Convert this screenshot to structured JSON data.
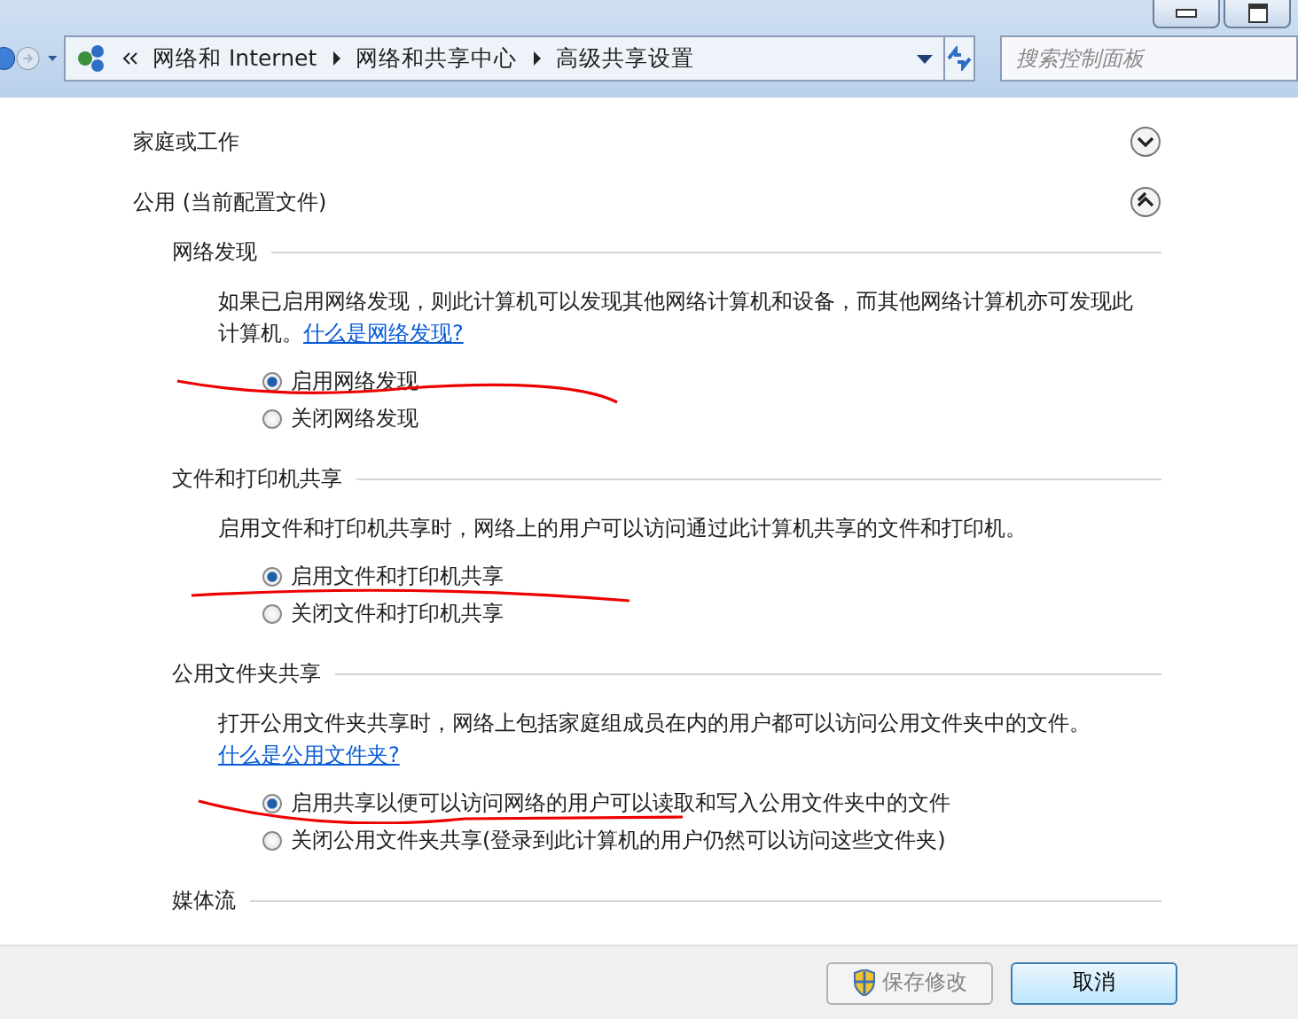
{
  "nav": {
    "breadcrumb": [
      "网络和 Internet",
      "网络和共享中心",
      "高级共享设置"
    ],
    "search": {
      "placeholder": "搜索控制面板"
    }
  },
  "profiles": [
    {
      "title": "家庭或工作",
      "expanded": false
    },
    {
      "title": "公用 (当前配置文件)",
      "expanded": true,
      "sections": [
        {
          "title": "网络发现",
          "description": "如果已启用网络发现，则此计算机可以发现其他网络计算机和设备，而其他网络计算机亦可发现此计算机。",
          "link": "什么是网络发现?",
          "options": [
            {
              "label": "启用网络发现",
              "selected": true
            },
            {
              "label": "关闭网络发现",
              "selected": false
            }
          ]
        },
        {
          "title": "文件和打印机共享",
          "description": "启用文件和打印机共享时，网络上的用户可以访问通过此计算机共享的文件和打印机。",
          "options": [
            {
              "label": "启用文件和打印机共享",
              "selected": true
            },
            {
              "label": "关闭文件和打印机共享",
              "selected": false
            }
          ]
        },
        {
          "title": "公用文件夹共享",
          "description": "打开公用文件夹共享时，网络上包括家庭组成员在内的用户都可以访问公用文件夹中的文件。",
          "link": "什么是公用文件夹?",
          "options": [
            {
              "label": "启用共享以便可以访问网络的用户可以读取和写入公用文件夹中的文件",
              "selected": true
            },
            {
              "label": "关闭公用文件夹共享(登录到此计算机的用户仍然可以访问这些文件夹)",
              "selected": false
            }
          ]
        },
        {
          "title": "媒体流"
        }
      ]
    }
  ],
  "footer": {
    "buttons": [
      {
        "label": "保存修改",
        "disabled": true,
        "kind": "elevated"
      },
      {
        "label": "取消",
        "disabled": false,
        "kind": "plain"
      }
    ]
  }
}
